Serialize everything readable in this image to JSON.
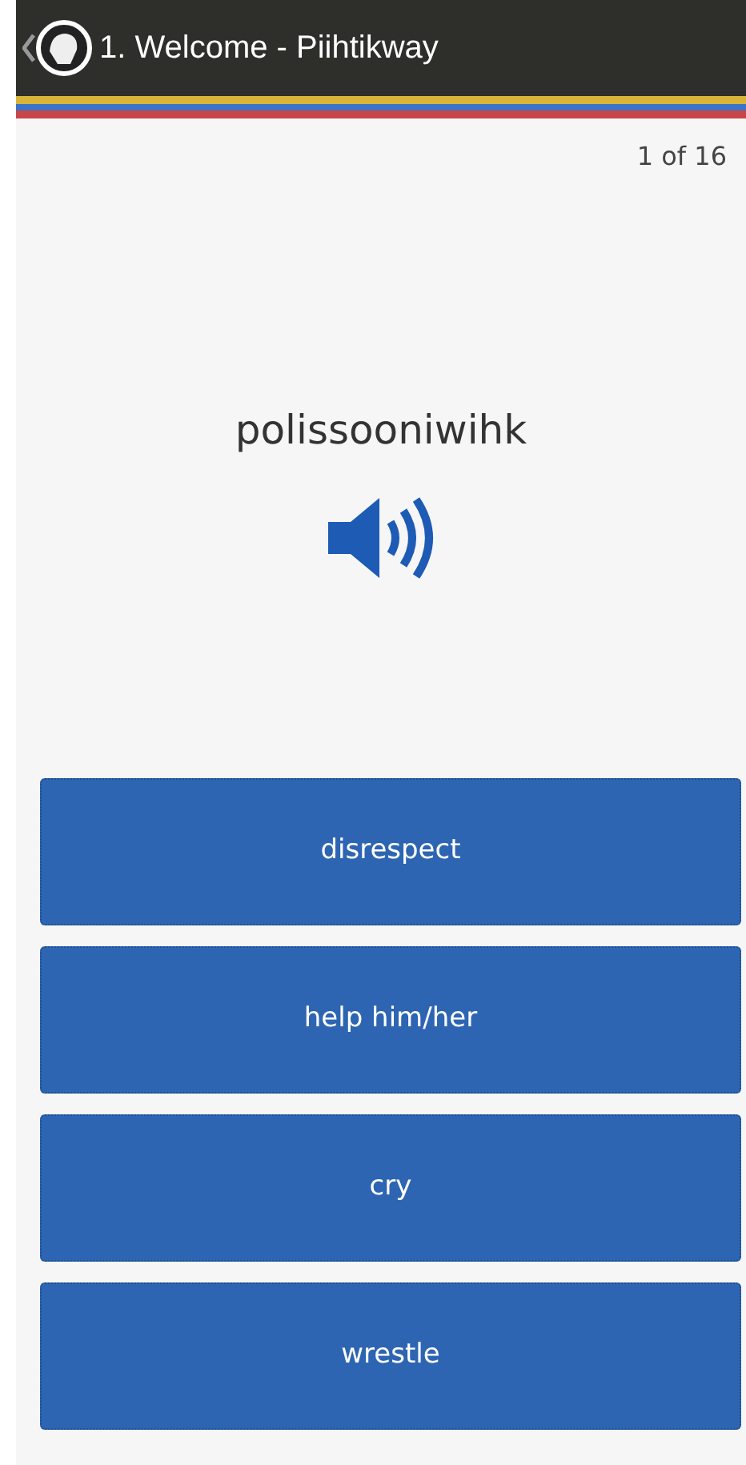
{
  "header": {
    "title": "1. Welcome - Piihtikway"
  },
  "progress": "1 of 16",
  "word": "polissooniwihk",
  "answers": [
    {
      "label": "disrespect"
    },
    {
      "label": "help him/her"
    },
    {
      "label": "cry"
    },
    {
      "label": "wrestle"
    }
  ]
}
